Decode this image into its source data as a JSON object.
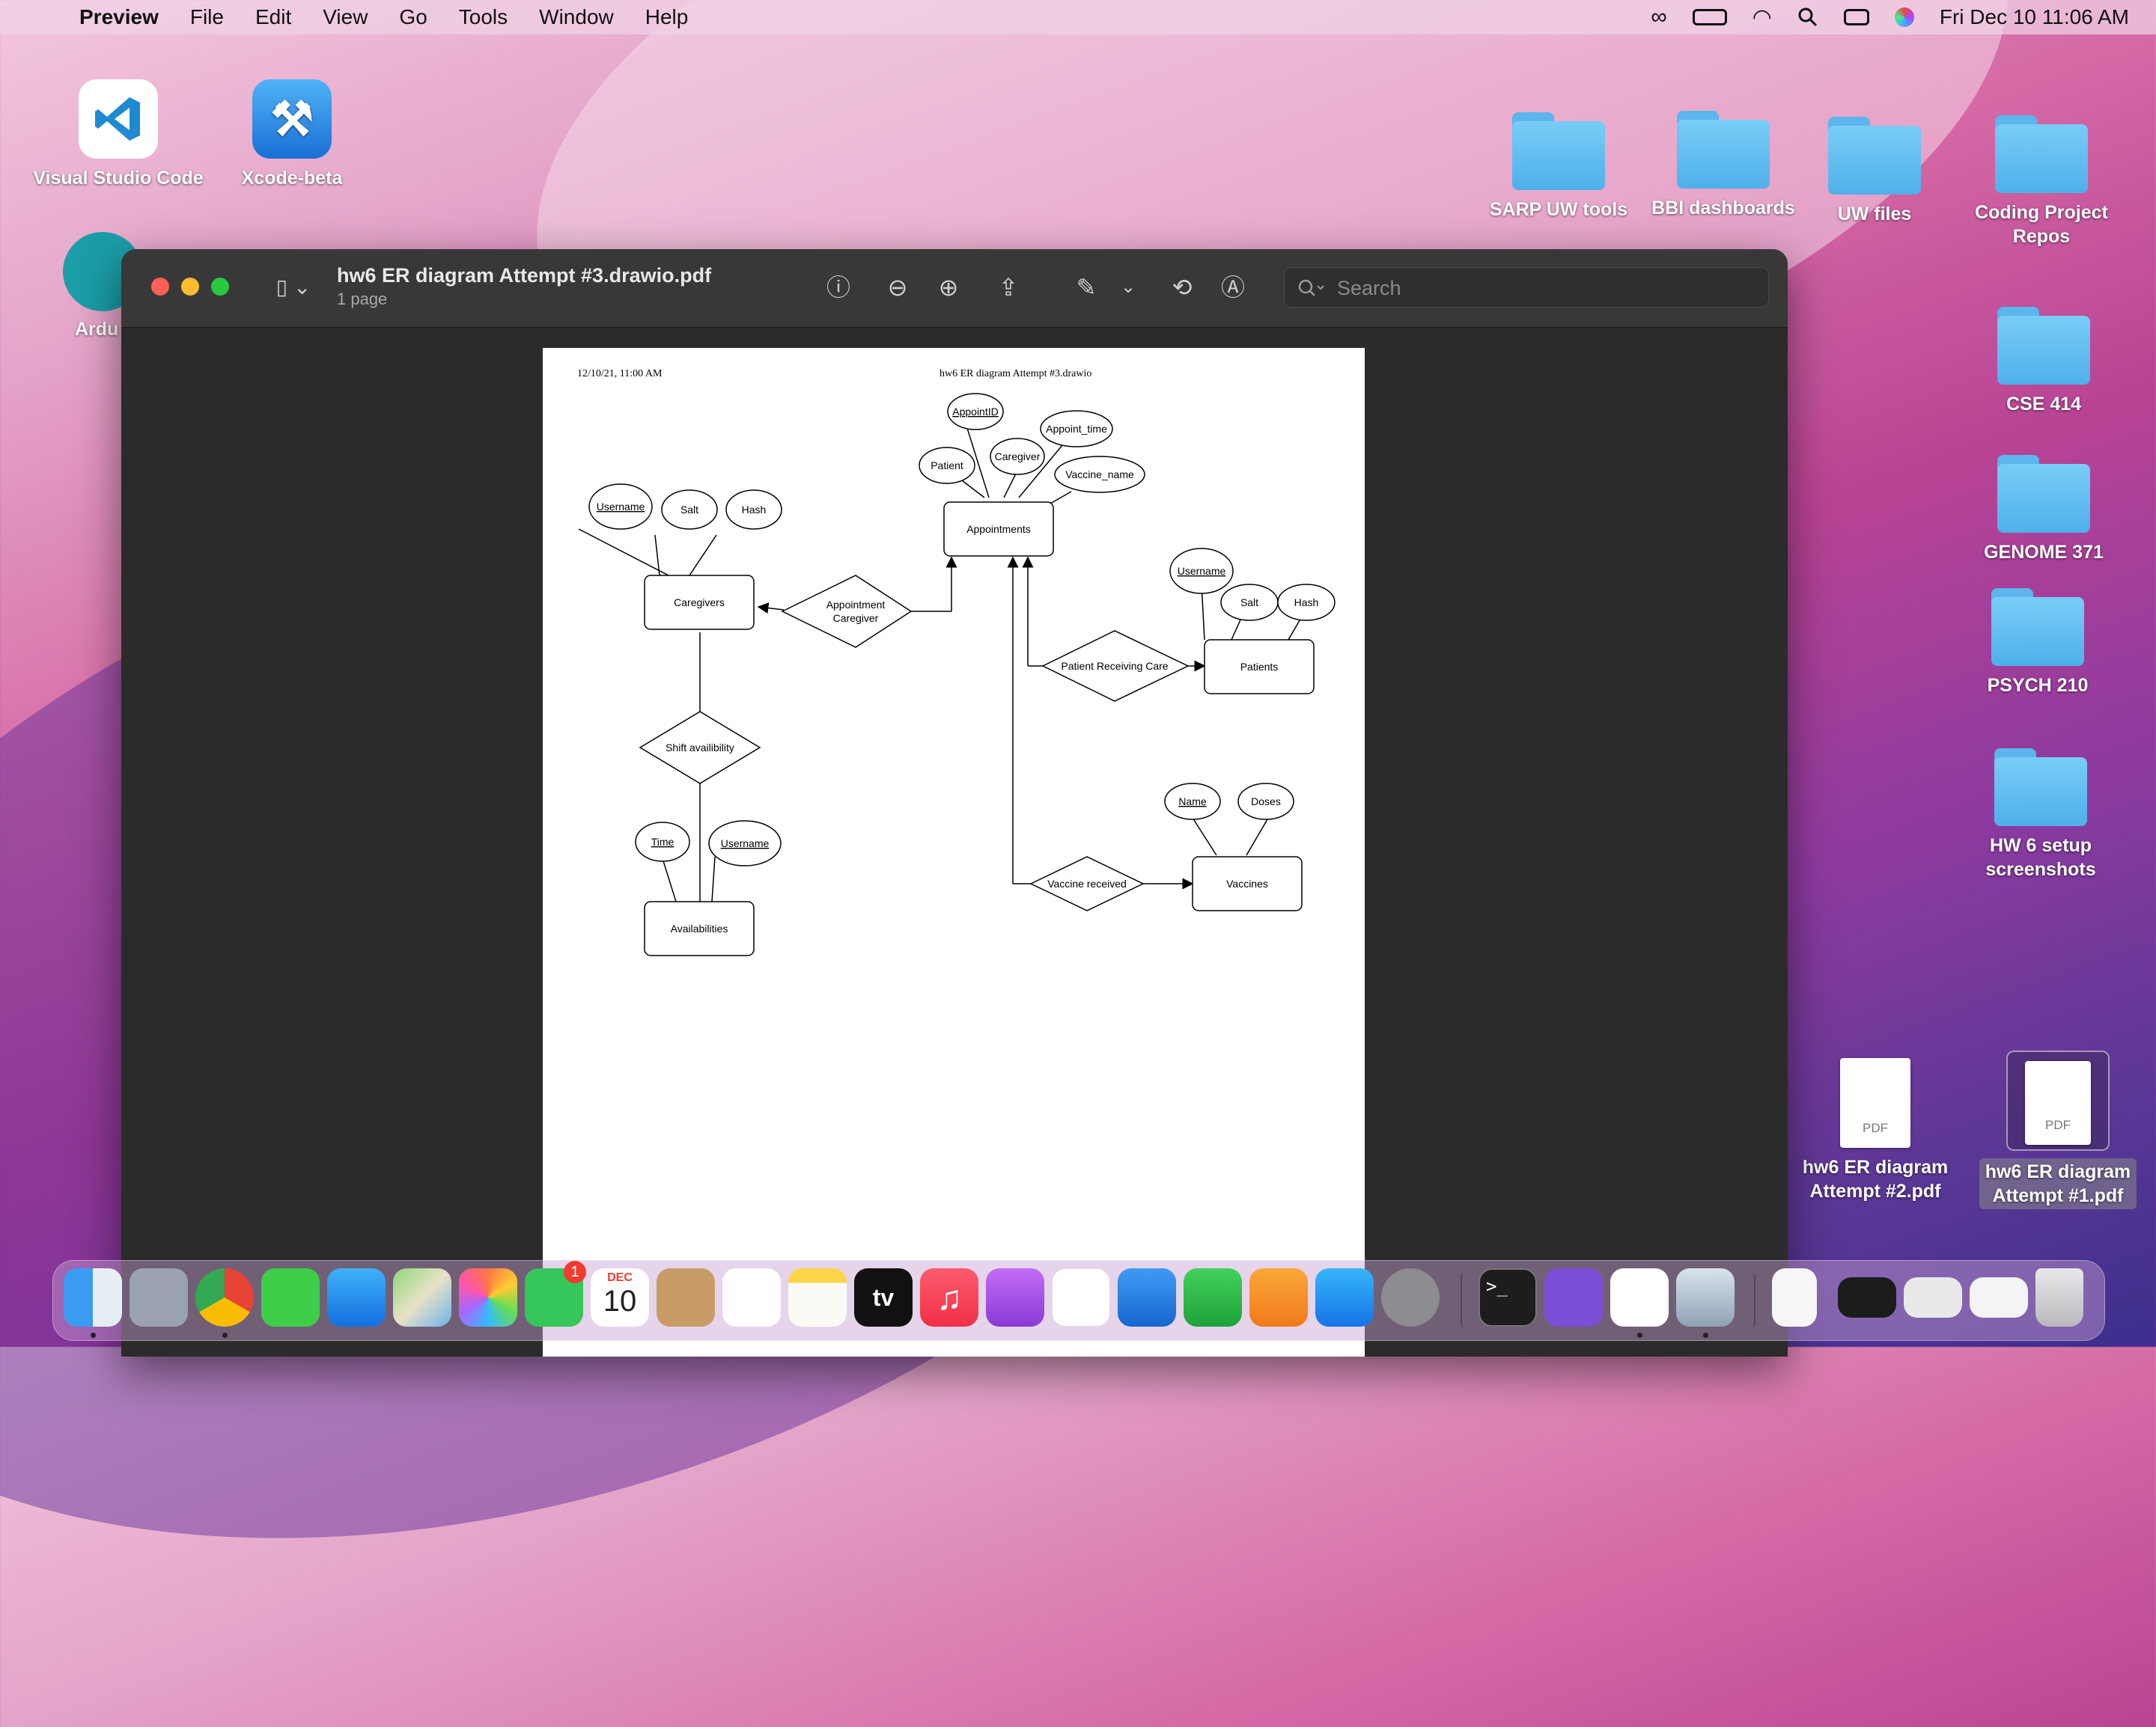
{
  "menubar": {
    "app_name": "Preview",
    "items": [
      "File",
      "Edit",
      "View",
      "Go",
      "Tools",
      "Window",
      "Help"
    ],
    "datetime": "Fri Dec 10  11:06 AM"
  },
  "desktop": {
    "apps": [
      {
        "label": "Visual Studio Code"
      },
      {
        "label": "Xcode-beta"
      },
      {
        "label": "Ardu"
      }
    ],
    "folders": [
      {
        "label": "SARP UW tools"
      },
      {
        "label": "BBI dashboards"
      },
      {
        "label": "UW files"
      },
      {
        "label": "Coding Project Repos"
      },
      {
        "label": "CSE 414"
      },
      {
        "label": "GENOME 371"
      },
      {
        "label": "PSYCH 210"
      },
      {
        "label": "HW 6 setup screenshots"
      }
    ],
    "files": [
      {
        "label": "hw6 ER diagram Attempt #2.pdf",
        "type": "PDF"
      },
      {
        "label": "hw6 ER diagram Attempt #1.pdf",
        "type": "PDF"
      }
    ]
  },
  "window": {
    "title": "hw6 ER diagram Attempt #3.drawio.pdf",
    "subtitle": "1 page",
    "search_placeholder": "Search"
  },
  "document": {
    "header_left": "12/10/21, 11:00 AM",
    "header_center": "hw6 ER diagram Attempt #3.drawio",
    "entities": {
      "caregivers": "Caregivers",
      "appointments": "Appointments",
      "patients": "Patients",
      "availabilities": "Availabilities",
      "vaccines": "Vaccines"
    },
    "relationships": {
      "appt_caregiver": [
        "Appointment",
        "Caregiver"
      ],
      "shift": "Shift availibility",
      "patient_care": "Patient Receiving Care",
      "vaccine_received": "Vaccine received"
    },
    "attributes": {
      "cg_username": "Username",
      "cg_salt": "Salt",
      "cg_hash": "Hash",
      "ap_id": "AppointID",
      "ap_time": "Appoint_time",
      "ap_caregiver": "Caregiver",
      "ap_patient": "Patient",
      "ap_vaccine": "Vaccine_name",
      "pt_username": "Username",
      "pt_salt": "Salt",
      "pt_hash": "Hash",
      "av_time": "Time",
      "av_username": "Username",
      "vx_name": "Name",
      "vx_doses": "Doses"
    }
  },
  "dock": {
    "calendar_month": "DEC",
    "calendar_day": "10",
    "facetime_badge": "1",
    "tv_label": "tv"
  },
  "colors": {
    "folder": "#5bb8ef",
    "window_bg": "#2b2b2b",
    "titlebar": "#383838",
    "close": "#fe5f57",
    "minimize": "#febc2e",
    "zoom": "#28c840"
  }
}
